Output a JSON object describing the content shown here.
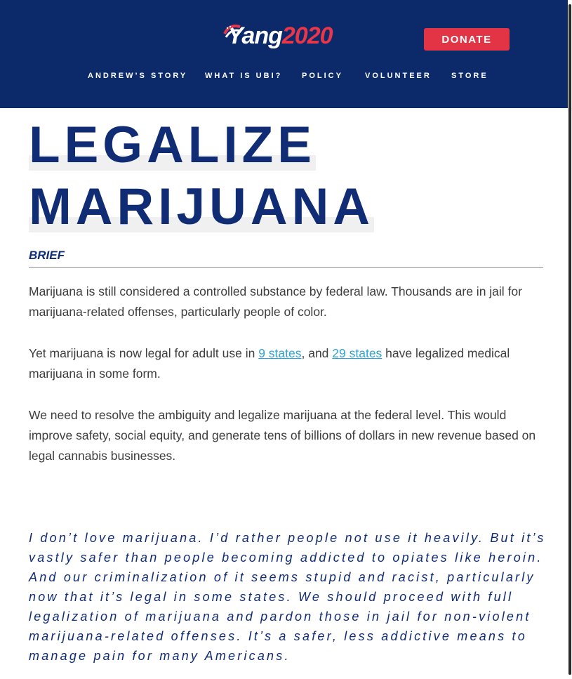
{
  "header": {
    "logo": {
      "name": "Yang",
      "year": "2020",
      "flag_icon": "us-flag-swoosh-icon",
      "colors": {
        "name": "#ffffff",
        "year": "#e8374a"
      }
    },
    "donate_label": "DONATE",
    "nav": [
      {
        "label": "ANDREW’S STORY"
      },
      {
        "label": "WHAT IS UBI?"
      },
      {
        "label": "POLICY"
      },
      {
        "label": "VOLUNTEER"
      },
      {
        "label": "STORE"
      }
    ],
    "background": "#0c2a6a"
  },
  "main": {
    "title_lines": [
      "LEGALIZE",
      "MARIJUANA"
    ],
    "brief_label": "BRIEF",
    "paragraphs": [
      "Marijuana is still considered a controlled substance by federal law. Thousands are in jail for marijuana-related offenses, particularly people of color.",
      {
        "before": "Yet marijuana is now legal for adult use in ",
        "link1": "9 states",
        "middle": ", and ",
        "link2": "29 states",
        "after": " have legalized medical marijuana in some form."
      },
      "We need to resolve the ambiguity and legalize marijuana at the federal level. This would improve safety, social equity, and generate tens of billions of dollars in new revenue based on legal cannabis businesses."
    ],
    "quote": "I don’t love marijuana. I’d rather people not use it heavily. But it’s vastly safer than people becoming addicted to opiates like heroin. And our criminalization of it seems stupid and racist, particularly now that it’s legal in some states. We should proceed with full legalization of marijuana and pardon those in jail for non-violent marijuana-related offenses. It’s a safer, less addictive means to manage pain for many Americans."
  },
  "colors": {
    "navy": "#102c74",
    "accent_red": "#e23445",
    "link": "#2ea3d6",
    "body_text": "#3d3d3d"
  }
}
